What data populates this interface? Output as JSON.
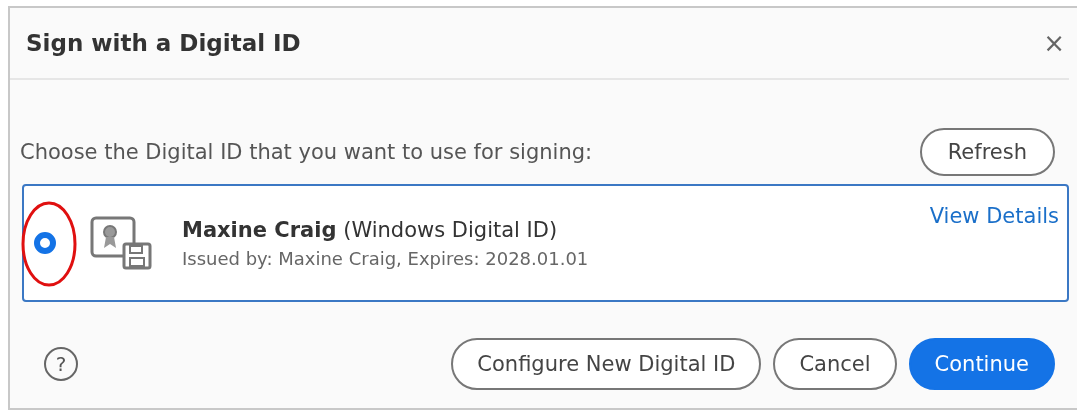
{
  "dialog": {
    "title": "Sign with a Digital ID",
    "close": "×"
  },
  "prompt": "Choose the Digital ID that you want to use for signing:",
  "refresh_button": "Refresh",
  "ids": [
    {
      "name": "Maxine Craig",
      "type": "(Windows Digital ID)",
      "issued": "Issued by: Maxine Craig, Expires: 2028.01.01",
      "link": "View Details",
      "selected": true
    }
  ],
  "annotation": {
    "kind": "ellipse"
  },
  "help": "?",
  "buttons": [
    {
      "label": "Configure New Digital ID",
      "kind": "secondary"
    },
    {
      "label": "Cancel",
      "kind": "secondary"
    },
    {
      "label": "Continue",
      "kind": "primary"
    }
  ]
}
